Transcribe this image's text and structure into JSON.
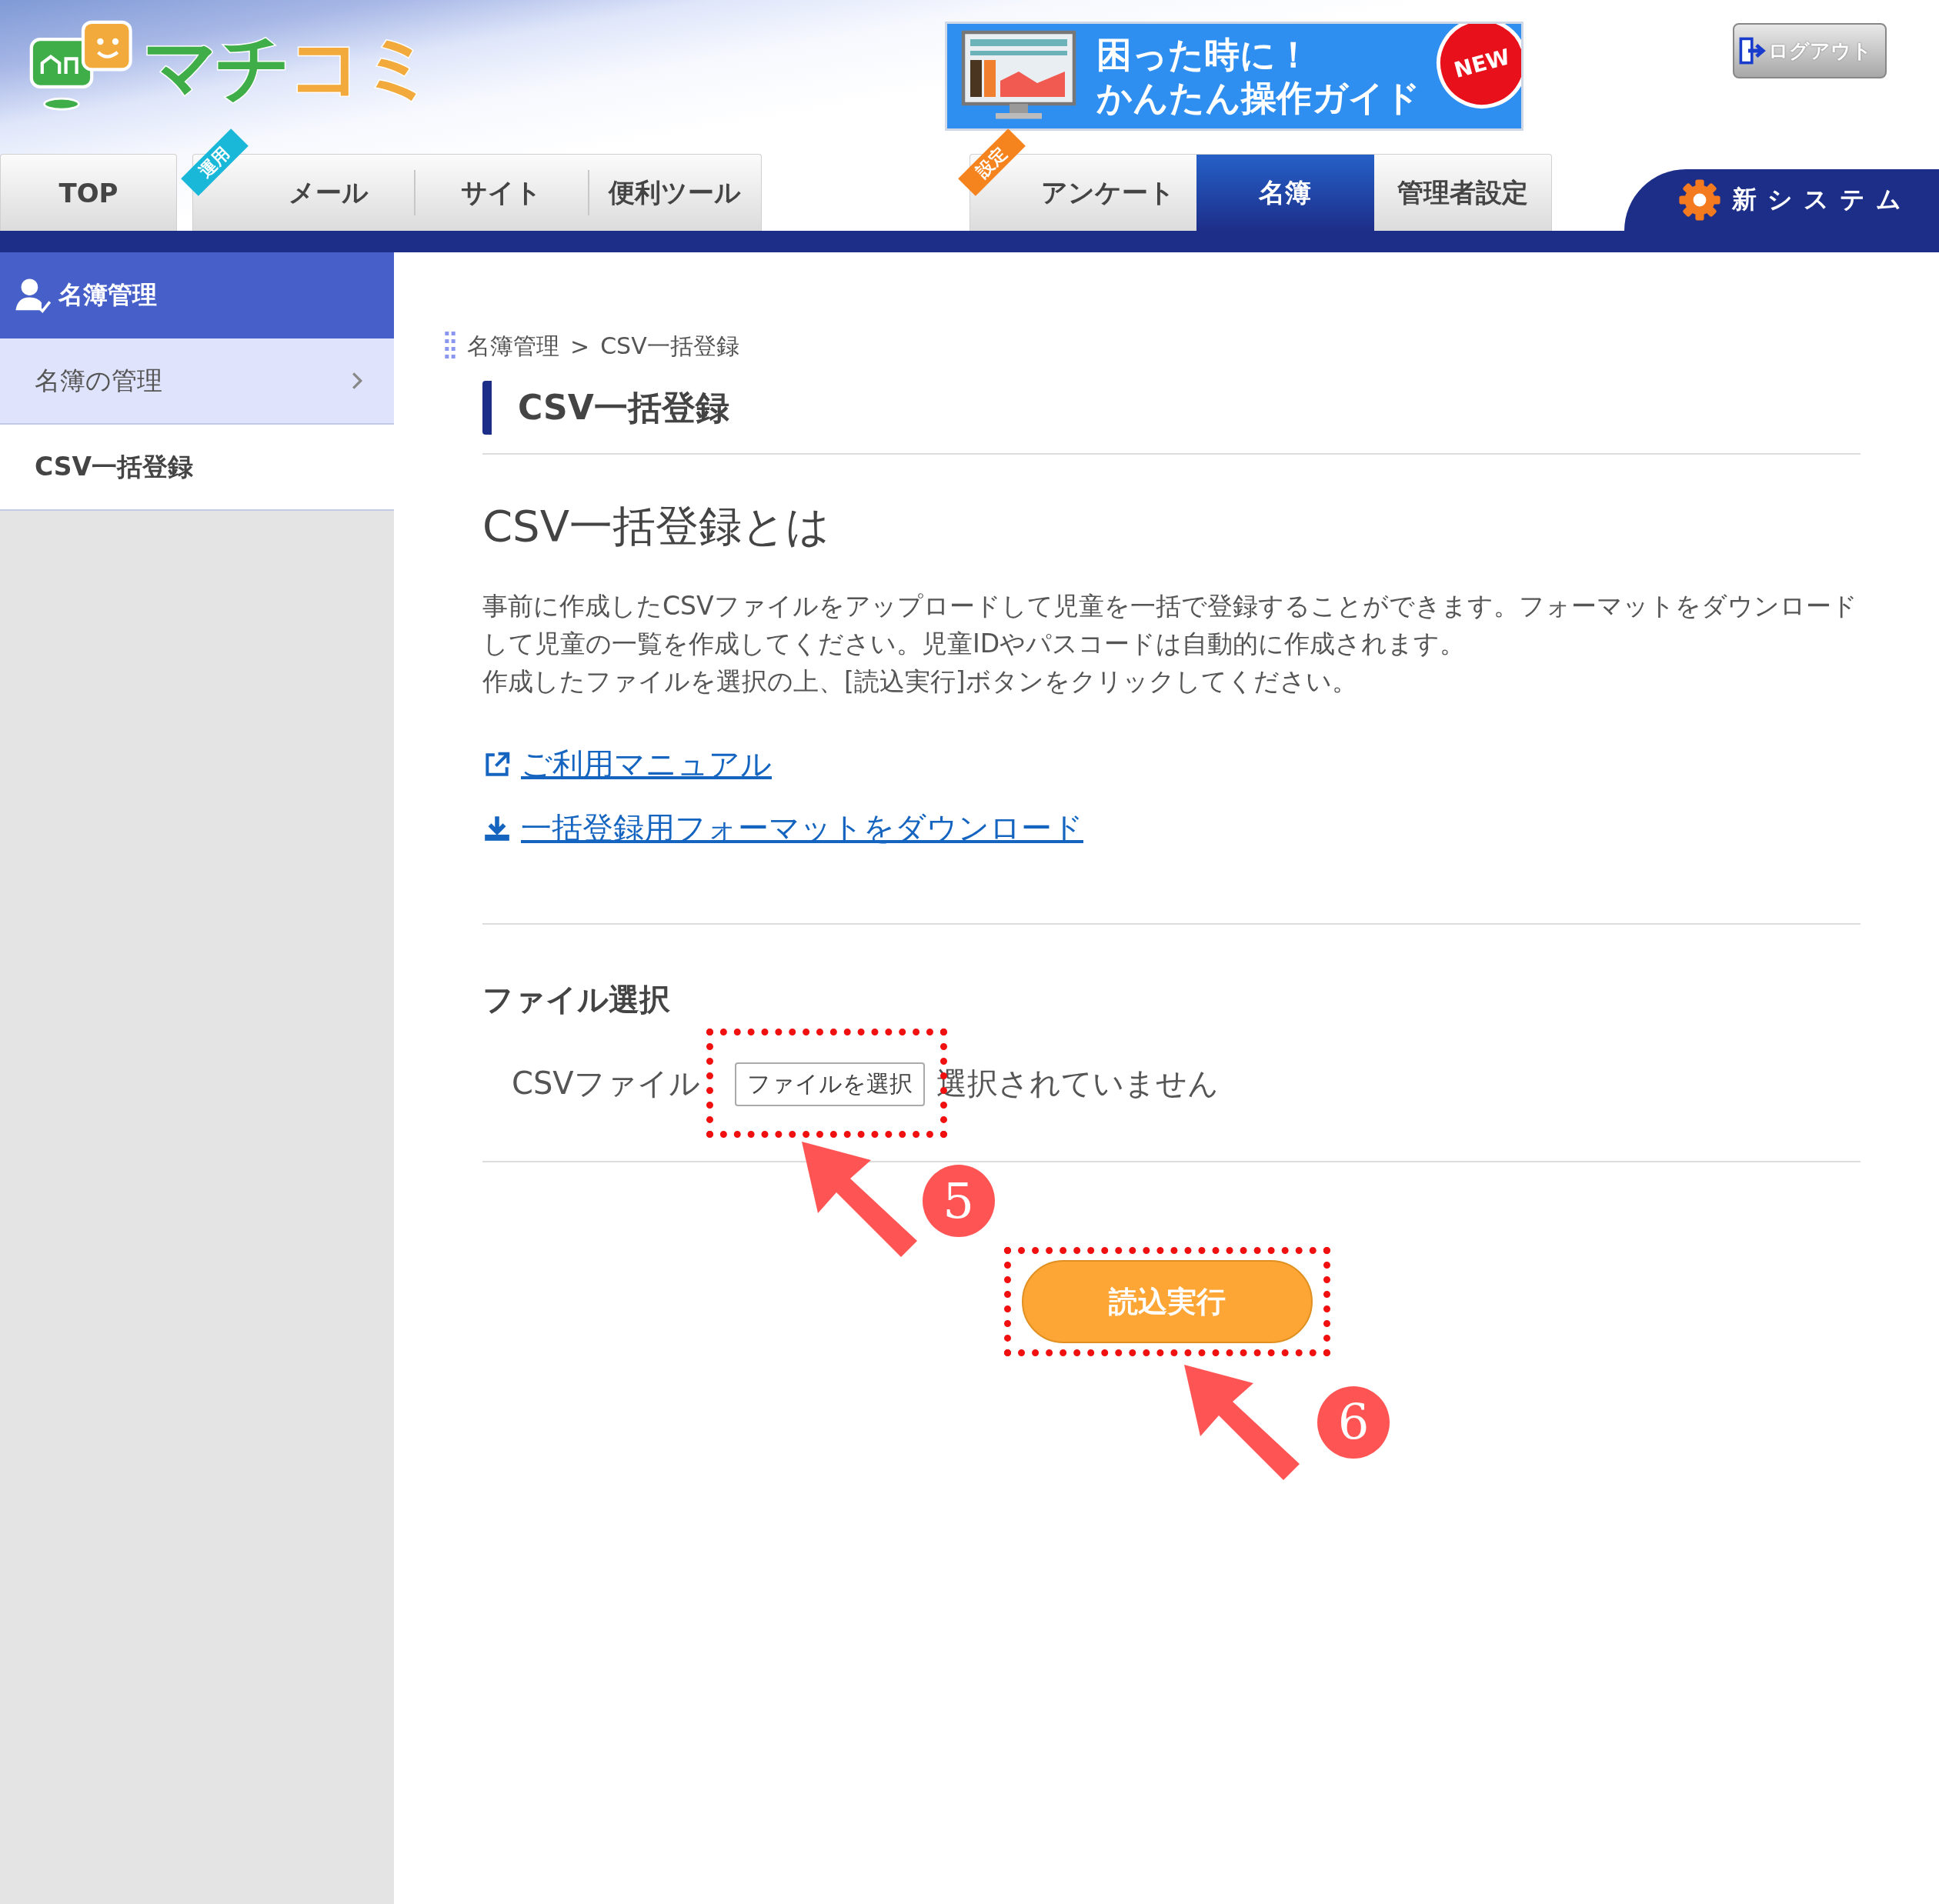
{
  "header": {
    "logo": {
      "parts": [
        "マチ",
        "コミ"
      ]
    },
    "guide_banner": {
      "lines": [
        "困った時に！",
        "かんたん操作ガイド"
      ],
      "badge": "NEW"
    },
    "logout_button": "ログアウト",
    "left_tab_groups": [
      {
        "tabs": [
          {
            "label": "TOP",
            "selected": false
          }
        ]
      },
      {
        "badge": "運用",
        "color": "#19b8d8",
        "tabs": [
          {
            "label": "メール",
            "selected": false
          },
          {
            "label": "サイト",
            "selected": false
          },
          {
            "label": "便利ツール",
            "selected": false
          }
        ]
      }
    ],
    "right_tab_groups": [
      {
        "badge": "設定",
        "color": "#f5841f",
        "tabs": [
          {
            "label": "アンケート",
            "selected": false
          },
          {
            "label": "名簿",
            "selected": true
          },
          {
            "label": "管理者設定",
            "selected": false
          }
        ]
      }
    ],
    "new_system_label": "新システム"
  },
  "sidebar": {
    "title": "名簿管理",
    "items": [
      {
        "label": "名簿の管理",
        "selected": false
      },
      {
        "label": "CSV一括登録",
        "selected": true
      }
    ]
  },
  "breadcrumb": [
    "名簿管理",
    "CSV一括登録"
  ],
  "breadcrumb_separator": ">",
  "page_title": "CSV一括登録",
  "section_heading": "CSV一括登録とは",
  "description": [
    "事前に作成したCSVファイルをアップロードして児童を一括で登録することができます。フォーマットをダウンロードして児童の一覧を作成してください。児童IDやパスコードは自動的に作成されます。",
    "作成したファイルを選択の上、[読込実行]ボタンをクリックしてください。"
  ],
  "links": [
    {
      "kind": "external",
      "label": "ご利用マニュアル"
    },
    {
      "kind": "download",
      "label": "一括登録用フォーマットをダウンロード"
    }
  ],
  "file_section": {
    "heading": "ファイル選択",
    "field_label": "CSVファイル",
    "choose_button": "ファイルを選択",
    "status": "選択されていません"
  },
  "submit_button": "読込実行",
  "annotations": [
    {
      "number": "5"
    },
    {
      "number": "6"
    }
  ]
}
